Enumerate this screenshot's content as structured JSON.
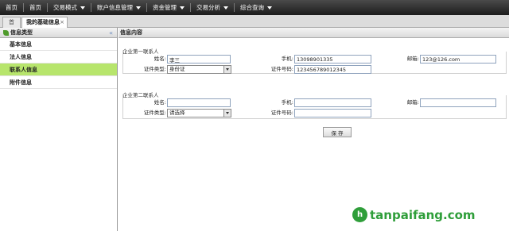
{
  "nav": {
    "items": [
      {
        "label": "首页",
        "has_menu": false
      },
      {
        "label": "首页",
        "has_menu": false
      },
      {
        "label": "交易模式",
        "has_menu": true
      },
      {
        "label": "账户信息管理",
        "has_menu": true
      },
      {
        "label": "资金管理",
        "has_menu": true
      },
      {
        "label": "交易分析",
        "has_menu": true
      },
      {
        "label": "综合查询",
        "has_menu": true
      }
    ]
  },
  "tabs": {
    "home": "首页",
    "active": "我的基础信息",
    "close": "×"
  },
  "sidebar": {
    "title": "信息类型",
    "collapse": "«",
    "items": [
      {
        "label": "基本信息",
        "active": false
      },
      {
        "label": "法人信息",
        "active": false
      },
      {
        "label": "联系人信息",
        "active": true
      },
      {
        "label": "附件信息",
        "active": false
      }
    ]
  },
  "main": {
    "title": "信息内容",
    "contact1": {
      "title": "企业第一联系人",
      "name_label": "姓名:",
      "name_value": "李三",
      "phone_label": "手机:",
      "phone_value": "13098901335",
      "email_label": "邮箱:",
      "email_value": "123@126.com",
      "idtype_label": "证件类型:",
      "idtype_value": "身份证",
      "idno_label": "证件号码:",
      "idno_value": "123456789012345"
    },
    "contact2": {
      "title": "企业第二联系人",
      "name_label": "姓名:",
      "name_value": "",
      "phone_label": "手机:",
      "phone_value": "",
      "email_label": "邮箱:",
      "email_value": "",
      "idtype_label": "证件类型:",
      "idtype_value": "请选择",
      "idno_label": "证件号码:",
      "idno_value": ""
    },
    "save_label": "保 存"
  },
  "watermark": {
    "logo_letter": "h",
    "text": "tanpaifang.com"
  },
  "colors": {
    "nav_bg": "#1c1c1c",
    "active_item": "#b7e56c",
    "brand_green": "#2f9e3a"
  }
}
